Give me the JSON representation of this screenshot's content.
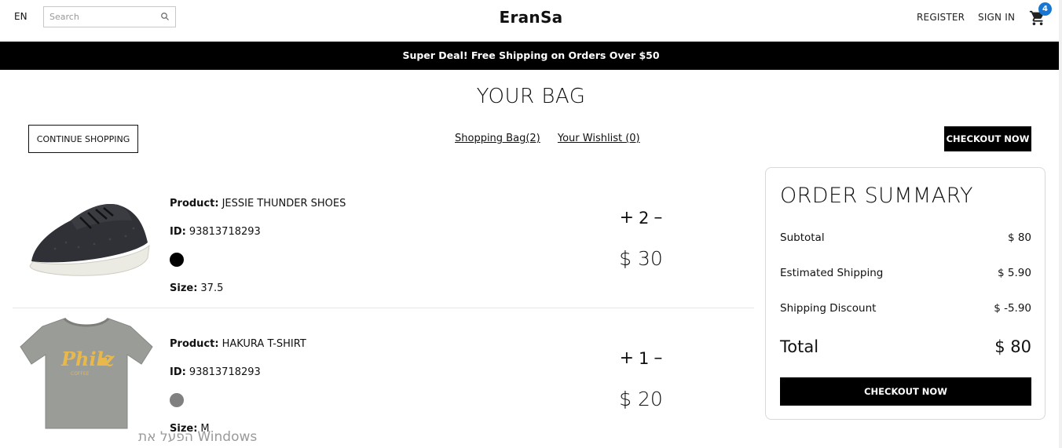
{
  "nav": {
    "lang": "EN",
    "search_placeholder": "Search",
    "logo": "EranSa",
    "register": "REGISTER",
    "signin": "SIGN IN",
    "cart_count": "4",
    "cart_icon": "cart-icon",
    "search_icon": "search-icon"
  },
  "announcement": "Super Deal! Free Shipping on Orders Over $50",
  "page_title": "YOUR BAG",
  "top": {
    "continue": "CONTINUE SHOPPING",
    "shopping_bag": "Shopping Bag(2)",
    "wishlist": "Your Wishlist (0)",
    "checkout": "CHECKOUT NOW"
  },
  "products": [
    {
      "product_label": "Product:",
      "product_name": "JESSIE THUNDER SHOES",
      "id_label": "ID:",
      "id": "93813718293",
      "color": "#000000",
      "size_label": "Size:",
      "size": "37.5",
      "qty": "2",
      "price": "$ 30"
    },
    {
      "product_label": "Product:",
      "product_name": "HAKURA T-SHIRT",
      "id_label": "ID:",
      "id": "93813718293",
      "color": "#808080",
      "size_label": "Size:",
      "size": "M",
      "qty": "1",
      "price": "$ 20"
    }
  ],
  "summary": {
    "title": "ORDER SUMMARY",
    "subtotal_label": "Subtotal",
    "subtotal": "$ 80",
    "shipping_label": "Estimated Shipping",
    "shipping": "$ 5.90",
    "discount_label": "Shipping Discount",
    "discount": "$ -5.90",
    "total_label": "Total",
    "total": "$ 80",
    "checkout": "CHECKOUT NOW"
  },
  "watermark": "הפעל את Windows",
  "colors": {
    "accent": "#1976d2",
    "banner": "#000000"
  }
}
